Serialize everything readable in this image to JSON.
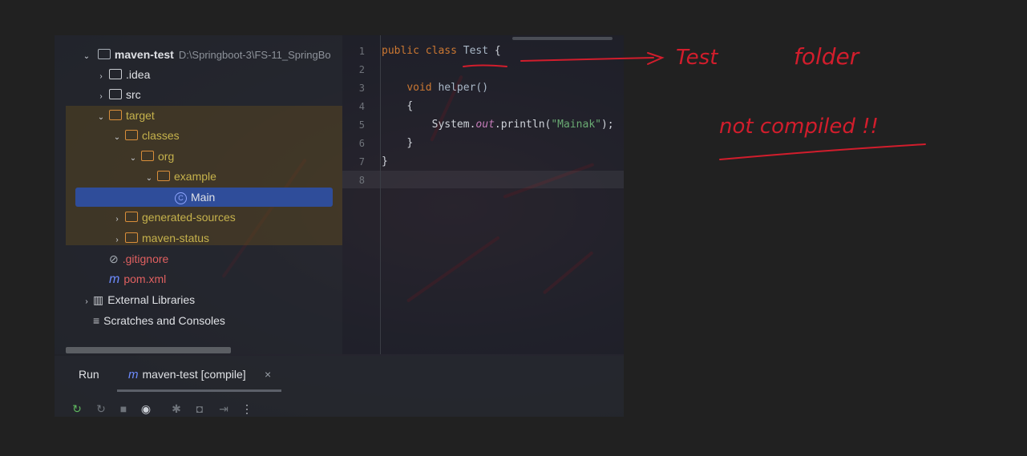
{
  "project_tree": {
    "root": {
      "name": "maven-test",
      "path": "D:\\Springboot-3\\FS-11_SpringBo"
    },
    "items": [
      {
        "label": ".idea"
      },
      {
        "label": "src"
      },
      {
        "label": "target"
      },
      {
        "label": "classes"
      },
      {
        "label": "org"
      },
      {
        "label": "example"
      },
      {
        "label": "Main"
      },
      {
        "label": "generated-sources"
      },
      {
        "label": "maven-status"
      },
      {
        "label": ".gitignore"
      },
      {
        "label": "pom.xml"
      },
      {
        "label": "External Libraries"
      },
      {
        "label": "Scratches and Consoles"
      }
    ]
  },
  "editor": {
    "line_numbers": [
      "1",
      "2",
      "3",
      "4",
      "5",
      "6",
      "7",
      "8"
    ],
    "code": {
      "l1_public": "public",
      "l1_class": "class",
      "l1_name": "Test",
      "l1_brace": "{",
      "l3_void": "void",
      "l3_method": "helper()",
      "l4": "{",
      "l5_system": "System.",
      "l5_out": "out",
      "l5_println": ".println(",
      "l5_string": "\"Mainak\"",
      "l5_end": ");",
      "l6": "}",
      "l7": "}"
    }
  },
  "run_panel": {
    "title": "Run",
    "tab_label": "maven-test [compile]",
    "close": "×",
    "tools": [
      "rerun-icon",
      "rerun-failed-icon",
      "stop-icon",
      "eye-icon",
      "debug-icon",
      "camera-icon",
      "exit-icon",
      "more-icon"
    ]
  },
  "annotations": {
    "arrow_label": "Test",
    "folder_word": "folder",
    "note": "not compiled !!",
    "ink_color": "#d21d2c"
  }
}
